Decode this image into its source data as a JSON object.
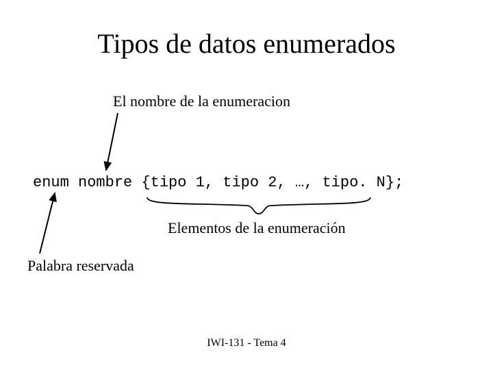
{
  "title": "Tipos de datos enumerados",
  "label_nombre": "El  nombre de la enumeracion",
  "code_line": "enum nombre {tipo 1, tipo 2, …, tipo. N};",
  "label_elementos": "Elementos de la enumeración",
  "label_palabra": "Palabra reservada",
  "footer": "IWI-131 - Tema 4"
}
